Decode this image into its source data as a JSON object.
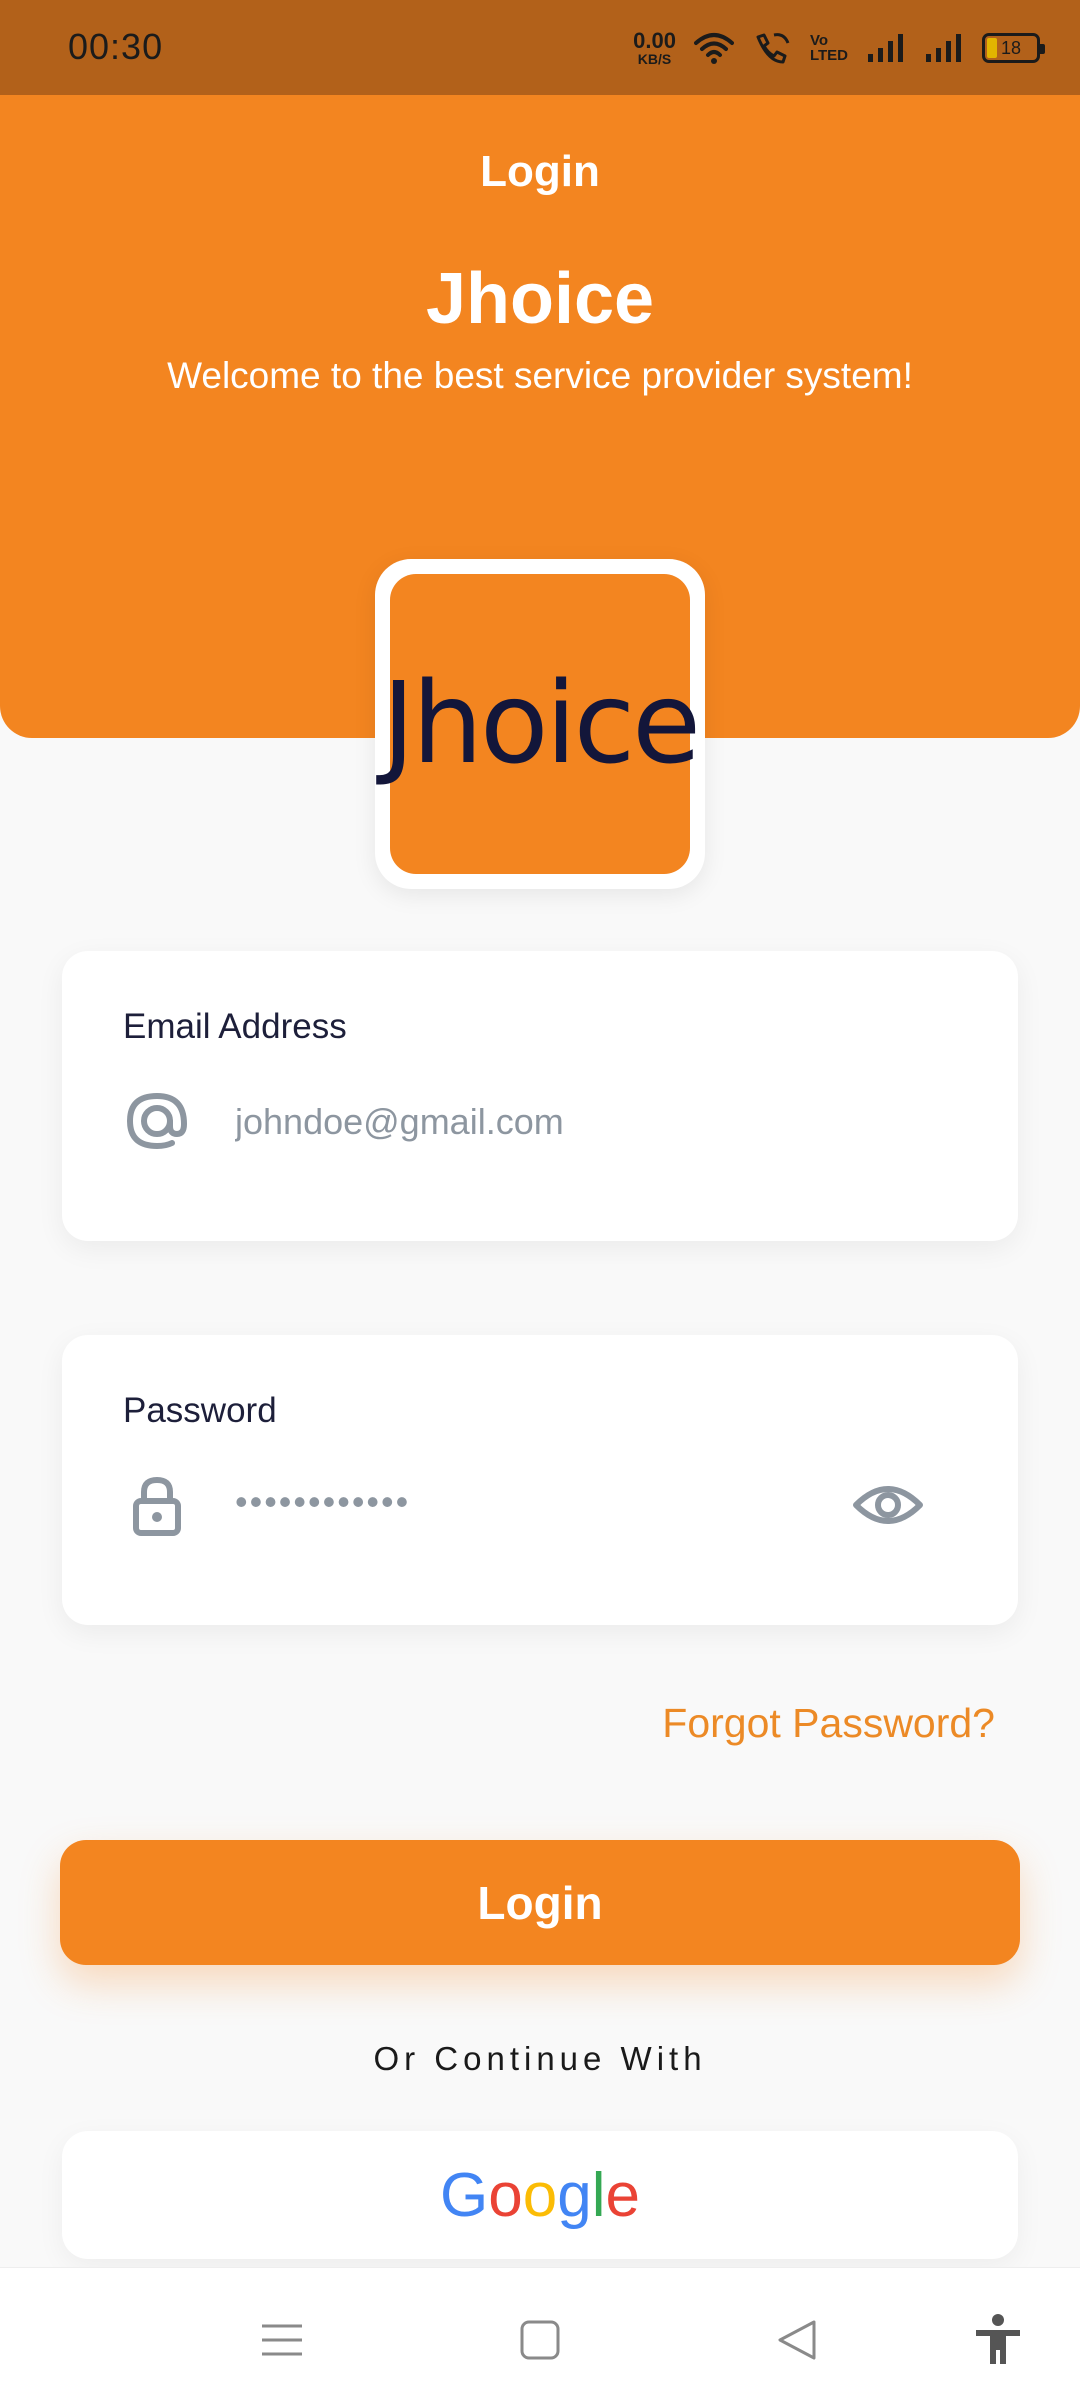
{
  "status_bar": {
    "time": "00:30",
    "net_speed_value": "0.00",
    "net_speed_unit": "KB/S",
    "volte_top": "Vo",
    "volte_bottom": "LTED",
    "battery": "18",
    "icons": [
      "wifi-icon",
      "wifi-call-icon",
      "volte-icon",
      "signal-icon",
      "signal-icon",
      "battery-icon"
    ]
  },
  "header": {
    "title": "Login",
    "app_name": "Jhoice",
    "tagline": "Welcome to the best service provider system!"
  },
  "logo": {
    "text": "Jhoice",
    "bg_color": "#f38520",
    "text_color": "#13163a"
  },
  "email": {
    "label": "Email Address",
    "placeholder": "johndoe@gmail.com",
    "icon": "at-sign-icon"
  },
  "password": {
    "label": "Password",
    "masked_value": "••••••••••••",
    "icon": "lock-icon",
    "toggle_icon": "eye-icon"
  },
  "forgot_password": "Forgot Password?",
  "login_button": "Login",
  "or_continue": "Or Continue With",
  "google_button": {
    "letters": [
      "G",
      "o",
      "o",
      "g",
      "l",
      "e"
    ]
  },
  "colors": {
    "accent": "#f38520",
    "status_bar": "#b2611a",
    "text_dark": "#1d1f3a",
    "muted": "#8d96a0"
  },
  "nav_bar": {
    "icons": [
      "menu-icon",
      "home-square-icon",
      "back-triangle-icon",
      "accessibility-icon"
    ]
  }
}
